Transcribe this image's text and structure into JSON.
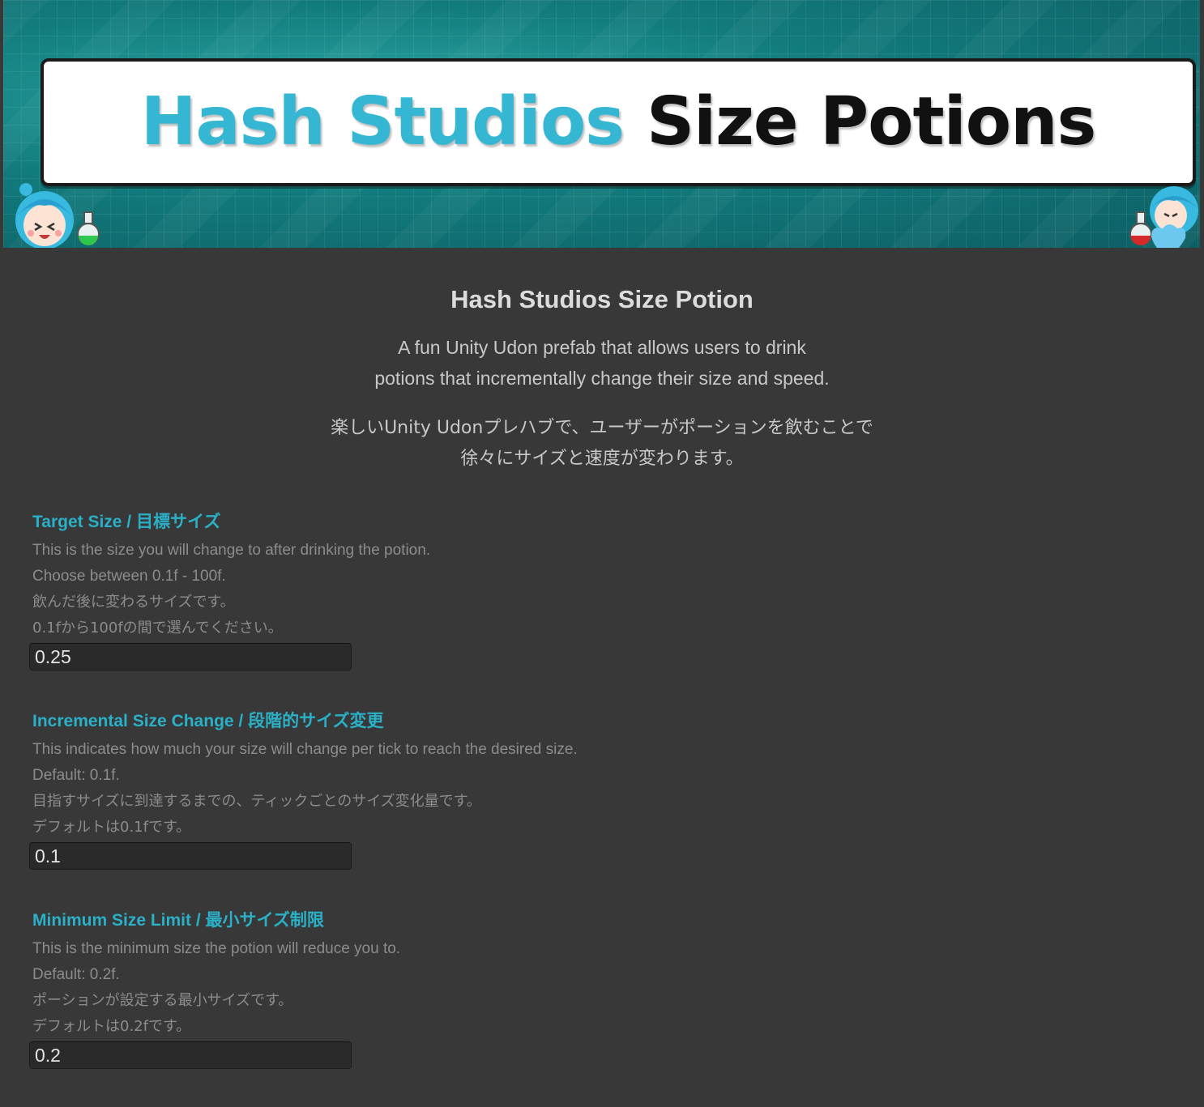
{
  "banner": {
    "logo_primary": "Hash Studios",
    "logo_secondary": "Size Potions",
    "accent_color": "#35b7d4"
  },
  "header": {
    "title": "Hash Studios Size Potion",
    "description_en": [
      "A fun Unity Udon prefab that allows users to drink",
      "potions that incrementally change their size and speed."
    ],
    "description_ja": [
      "楽しいUnity Udonプレハブで、ユーザーがポーションを飲むことで",
      "徐々にサイズと速度が変わります。"
    ]
  },
  "fields": [
    {
      "label": "Target Size / 目標サイズ",
      "help": [
        "This is the size you will change to after drinking the potion.",
        "Choose between 0.1f - 100f.",
        "飲んだ後に変わるサイズです。",
        "0.1fから100fの間で選んでください。"
      ],
      "value": "0.25"
    },
    {
      "label": "Incremental Size Change / 段階的サイズ変更",
      "help": [
        "This indicates how much your size will change per tick to reach the desired size.",
        "Default: 0.1f.",
        "目指すサイズに到達するまでの、ティックごとのサイズ変化量です。",
        "デフォルトは0.1fです。"
      ],
      "value": "0.1"
    },
    {
      "label": "Minimum Size Limit / 最小サイズ制限",
      "help": [
        "This is the minimum size the potion will reduce you to.",
        "Default: 0.2f.",
        "ポーションが設定する最小サイズです。",
        "デフォルトは0.2fです。"
      ],
      "value": "0.2"
    }
  ],
  "colors": {
    "background": "#383838",
    "label": "#2ab0c7",
    "help_text": "#8c8c8c",
    "input_bg": "#2a2a2a"
  }
}
